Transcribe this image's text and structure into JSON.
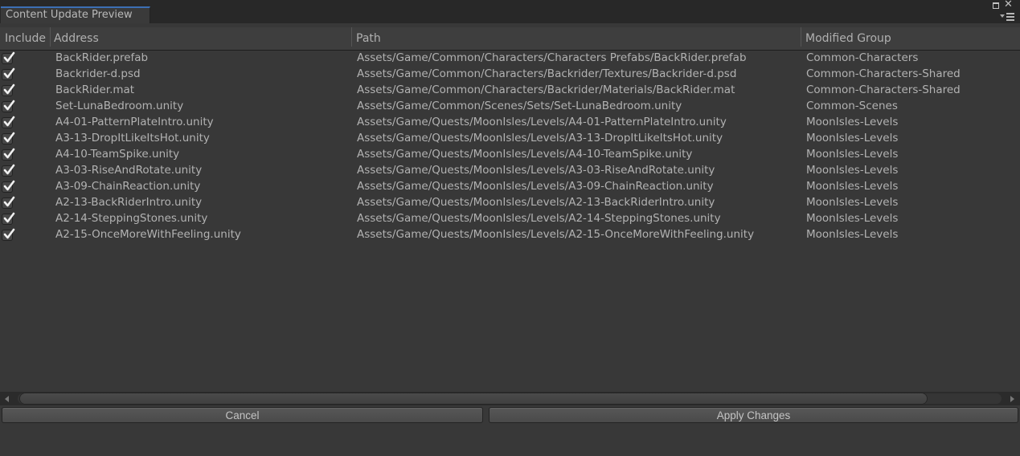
{
  "window": {
    "tab_title": "Content Update Preview",
    "icons": [
      "maximize-icon",
      "close-icon",
      "window-menu-icon"
    ]
  },
  "table": {
    "columns": {
      "include": "Include",
      "address": "Address",
      "path": "Path",
      "group": "Modified Group"
    },
    "rows": [
      {
        "include": true,
        "address": "BackRider.prefab",
        "path": "Assets/Game/Common/Characters/Characters Prefabs/BackRider.prefab",
        "group": "Common-Characters"
      },
      {
        "include": true,
        "address": "Backrider-d.psd",
        "path": "Assets/Game/Common/Characters/Backrider/Textures/Backrider-d.psd",
        "group": "Common-Characters-Shared"
      },
      {
        "include": true,
        "address": "BackRider.mat",
        "path": "Assets/Game/Common/Characters/Backrider/Materials/BackRider.mat",
        "group": "Common-Characters-Shared"
      },
      {
        "include": true,
        "address": "Set-LunaBedroom.unity",
        "path": "Assets/Game/Common/Scenes/Sets/Set-LunaBedroom.unity",
        "group": "Common-Scenes"
      },
      {
        "include": true,
        "address": "A4-01-PatternPlateIntro.unity",
        "path": "Assets/Game/Quests/MoonIsles/Levels/A4-01-PatternPlateIntro.unity",
        "group": "MoonIsles-Levels"
      },
      {
        "include": true,
        "address": "A3-13-DropItLikeItsHot.unity",
        "path": "Assets/Game/Quests/MoonIsles/Levels/A3-13-DropItLikeItsHot.unity",
        "group": "MoonIsles-Levels"
      },
      {
        "include": true,
        "address": "A4-10-TeamSpike.unity",
        "path": "Assets/Game/Quests/MoonIsles/Levels/A4-10-TeamSpike.unity",
        "group": "MoonIsles-Levels"
      },
      {
        "include": true,
        "address": "A3-03-RiseAndRotate.unity",
        "path": "Assets/Game/Quests/MoonIsles/Levels/A3-03-RiseAndRotate.unity",
        "group": "MoonIsles-Levels"
      },
      {
        "include": true,
        "address": "A3-09-ChainReaction.unity",
        "path": "Assets/Game/Quests/MoonIsles/Levels/A3-09-ChainReaction.unity",
        "group": "MoonIsles-Levels"
      },
      {
        "include": true,
        "address": "A2-13-BackRiderIntro.unity",
        "path": "Assets/Game/Quests/MoonIsles/Levels/A2-13-BackRiderIntro.unity",
        "group": "MoonIsles-Levels"
      },
      {
        "include": true,
        "address": "A2-14-SteppingStones.unity",
        "path": "Assets/Game/Quests/MoonIsles/Levels/A2-14-SteppingStones.unity",
        "group": "MoonIsles-Levels"
      },
      {
        "include": true,
        "address": "A2-15-OnceMoreWithFeeling.unity",
        "path": "Assets/Game/Quests/MoonIsles/Levels/A2-15-OnceMoreWithFeeling.unity",
        "group": "MoonIsles-Levels"
      }
    ]
  },
  "footer": {
    "cancel_label": "Cancel",
    "apply_label": "Apply Changes"
  },
  "colors": {
    "background": "#383838",
    "tab_accent": "#3c6fb4",
    "text": "#b2b2b2"
  }
}
